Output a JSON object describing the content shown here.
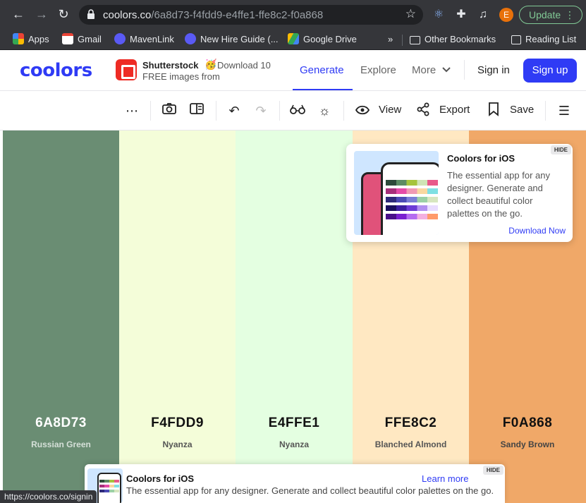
{
  "browser": {
    "url_host": "coolors.co",
    "url_path": "/6a8d73-f4fdd9-e4ffe1-ffe8c2-f0a868",
    "avatar_letter": "E",
    "update_label": "Update",
    "bookmarks": [
      {
        "label": "Apps",
        "icon": "apps-grid-icon"
      },
      {
        "label": "Gmail",
        "icon": "gmail-icon"
      },
      {
        "label": "MavenLink",
        "icon": "mavenlink-icon"
      },
      {
        "label": "New Hire Guide (...",
        "icon": "mavenlink-icon"
      },
      {
        "label": "Google Drive",
        "icon": "google-drive-icon"
      }
    ],
    "bookmarks_overflow": "»",
    "other_bookmarks": "Other Bookmarks",
    "reading_list": "Reading List",
    "status_url": "https://coolors.co/signin"
  },
  "header": {
    "logo": "coolors",
    "ad": {
      "title": "Shutterstock",
      "emoji": "🥳",
      "text_line1": "Download 10",
      "text_line2": "FREE images from"
    },
    "nav": {
      "generate": "Generate",
      "explore": "Explore",
      "more": "More"
    },
    "sign_in": "Sign in",
    "sign_up": "Sign up"
  },
  "toolbar": {
    "view_label": "View",
    "export_label": "Export",
    "save_label": "Save"
  },
  "palette": [
    {
      "hex": "6A8D73",
      "name": "Russian Green",
      "color": "#6A8D73",
      "text_color": "#ffffff",
      "name_color": "#d5e0d8"
    },
    {
      "hex": "F4FDD9",
      "name": "Nyanza",
      "color": "#F4FDD9",
      "text_color": "#111111",
      "name_color": "#555555"
    },
    {
      "hex": "E4FFE1",
      "name": "Nyanza",
      "color": "#E4FFE1",
      "text_color": "#111111",
      "name_color": "#555555"
    },
    {
      "hex": "FFE8C2",
      "name": "Blanched Almond",
      "color": "#FFE8C2",
      "text_color": "#111111",
      "name_color": "#555555"
    },
    {
      "hex": "F0A868",
      "name": "Sandy Brown",
      "color": "#F0A868",
      "text_color": "#111111",
      "name_color": "#444444"
    }
  ],
  "ios_card": {
    "hide": "HIDE",
    "title": "Coolors for iOS",
    "body": "The essential app for any designer. Generate and collect beautiful color palettes on the go.",
    "link": "Download Now"
  },
  "bottom_banner": {
    "hide": "HIDE",
    "title": "Coolors for iOS",
    "body": "The essential app for any designer. Generate and collect beautiful color palettes on the go.",
    "link": "Learn more"
  }
}
